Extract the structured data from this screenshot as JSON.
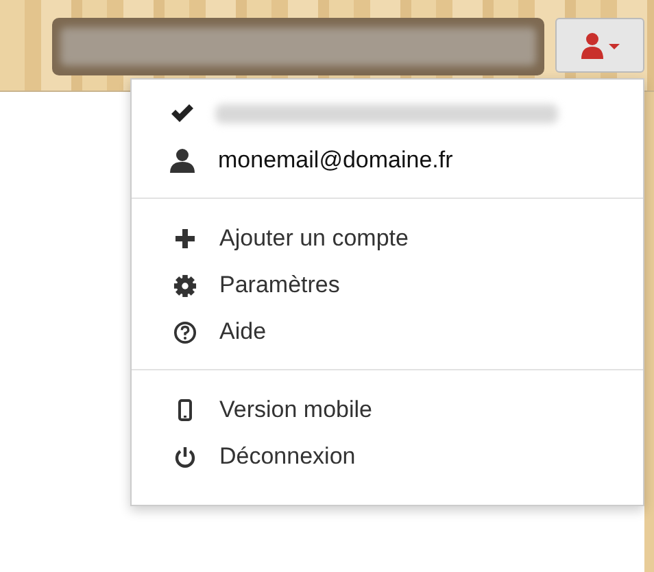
{
  "accounts": [
    {
      "selected": true
    },
    {
      "email": "monemail@domaine.fr",
      "selected": false
    }
  ],
  "groups": [
    [
      {
        "kind": "add",
        "label": "Ajouter un compte"
      },
      {
        "kind": "settings",
        "label": "Paramètres"
      },
      {
        "kind": "help",
        "label": "Aide"
      }
    ],
    [
      {
        "kind": "mobile",
        "label": "Version mobile"
      },
      {
        "kind": "logout",
        "label": "Déconnexion"
      }
    ]
  ]
}
